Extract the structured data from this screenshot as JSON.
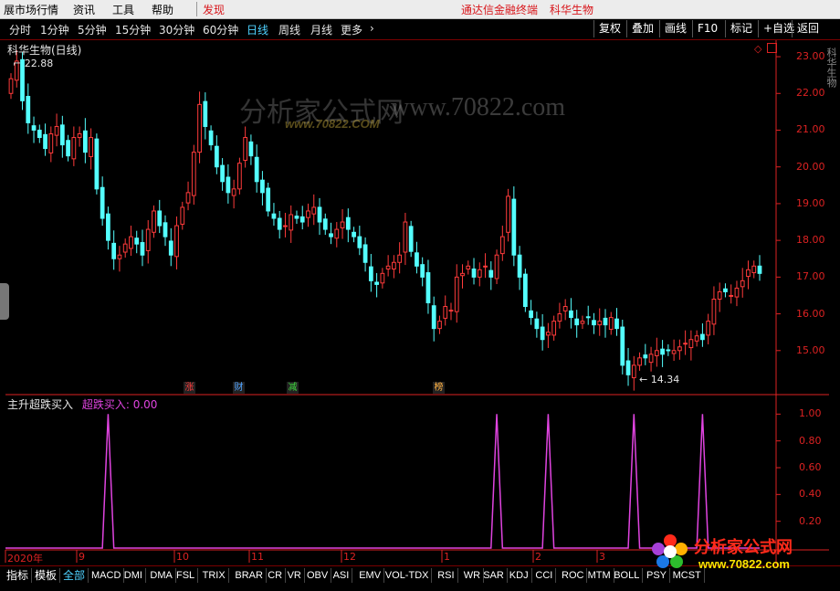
{
  "menu": {
    "items": [
      "展市场行情",
      "资讯",
      "工具",
      "帮助"
    ],
    "discover": "发现",
    "app_name": "通达信金融终端",
    "stock_name": "科华生物"
  },
  "periods": [
    "分时",
    "1分钟",
    "5分钟",
    "15分钟",
    "30分钟",
    "60分钟",
    "日线",
    "周线",
    "月线",
    "更多"
  ],
  "active_period": "日线",
  "more_arrow": "›",
  "right_buttons": [
    "复权",
    "叠加",
    "画线",
    "F10",
    "标记",
    "+自选",
    "返回"
  ],
  "chart_title": "科华生物(日线)",
  "high_label": "22.88",
  "low_label": "14.34",
  "indicator": {
    "name": "主升超跌买入",
    "series_label": "超跌买入: 0.00"
  },
  "badges": [
    {
      "text": "涨",
      "color": "#ff3b3b"
    },
    {
      "text": "财",
      "color": "#4fa3ff"
    },
    {
      "text": "减",
      "color": "#3fdc3f"
    },
    {
      "text": "榜",
      "color": "#ffb040"
    }
  ],
  "x_labels": [
    "2020年",
    "9",
    "10",
    "11",
    "12",
    "1",
    "2",
    "3"
  ],
  "tabs": [
    "指标",
    "模板",
    "全部",
    "MACD",
    "DMI",
    "DMA",
    "FSL",
    "TRIX",
    "BRAR",
    "CR",
    "VR",
    "OBV",
    "ASI",
    "EMV",
    "VOL-TDX",
    "RSI",
    "WR",
    "SAR",
    "KDJ",
    "CCI",
    "ROC",
    "MTM",
    "BOLL",
    "PSY",
    "MCST"
  ],
  "active_tab": "全部",
  "watermark": {
    "cn": "分析家公式网",
    "url": "www.70822.com",
    "small": "www.70822.COM"
  },
  "logo": {
    "text": "分析家公式网",
    "url": "www.70822.com"
  },
  "side_text": "科华生物",
  "colors": {
    "up": "#ff3b3b",
    "down": "#54ffff",
    "axis": "#dd2222",
    "indicator": "#e044e0",
    "active": "#4fd2ff"
  },
  "chart_data": {
    "type": "candlestick",
    "y_axis_ticks": [
      23.0,
      22.0,
      21.0,
      20.0,
      19.0,
      18.0,
      17.0,
      16.0,
      15.0
    ],
    "ylim": [
      14.0,
      23.3
    ],
    "indicator_ticks": [
      1.0,
      0.8,
      0.6,
      0.4,
      0.2
    ],
    "indicator_ylim": [
      0,
      1.05
    ],
    "price_path": [
      22.4,
      22.88,
      21.8,
      21.2,
      21.0,
      20.8,
      20.5,
      20.9,
      21.1,
      20.6,
      20.3,
      20.8,
      20.9,
      20.4,
      20.8,
      19.4,
      18.6,
      18.0,
      17.5,
      17.6,
      17.9,
      18.1,
      17.9,
      17.6,
      18.3,
      18.8,
      18.4,
      18.1,
      17.6,
      18.4,
      18.9,
      19.3,
      20.4,
      21.7,
      21.1,
      20.6,
      20.0,
      19.6,
      19.3,
      19.4,
      20.1,
      20.8,
      20.3,
      19.6,
      19.3,
      18.8,
      18.6,
      18.3,
      18.4,
      18.7,
      18.6,
      18.5,
      18.8,
      18.9,
      18.5,
      18.3,
      18.1,
      18.3,
      18.5,
      18.3,
      18.1,
      17.8,
      17.4,
      16.9,
      16.8,
      17.1,
      17.3,
      17.4,
      17.6,
      18.5,
      17.7,
      17.3,
      17.0,
      16.3,
      15.6,
      15.8,
      16.2,
      16.1,
      17.0,
      17.1,
      17.3,
      17.0,
      17.2,
      17.3,
      17.0,
      17.6,
      18.1,
      19.2,
      17.6,
      17.0,
      16.2,
      15.9,
      15.6,
      15.3,
      15.5,
      15.8,
      16.0,
      16.2,
      15.9,
      15.7,
      15.8,
      15.9,
      15.7,
      15.8,
      15.7,
      15.9,
      15.6,
      14.6,
      14.34,
      14.6,
      14.8,
      14.8,
      14.9,
      15.0,
      14.9,
      15.0,
      15.0,
      15.1,
      15.2,
      15.3,
      15.4,
      15.3,
      15.8,
      16.4,
      16.6,
      16.6,
      16.5,
      16.7,
      16.9,
      17.2,
      17.3,
      17.1
    ],
    "signal_peaks_at_index": [
      17,
      85,
      94,
      109,
      121
    ],
    "signal_value": 1.0
  }
}
